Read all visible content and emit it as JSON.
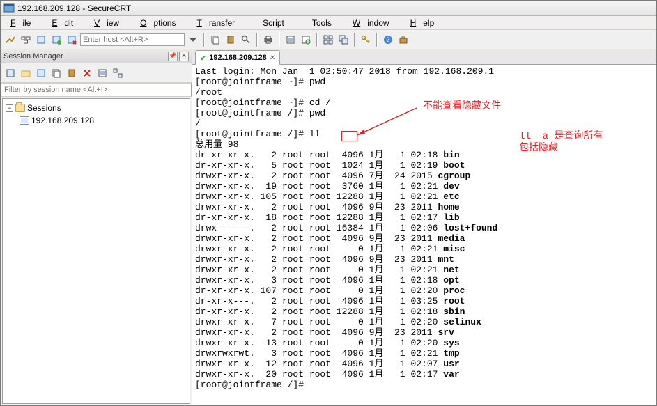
{
  "window": {
    "title": "192.168.209.128 - SecureCRT"
  },
  "menu": {
    "file": "File",
    "edit": "Edit",
    "view": "View",
    "options": "Options",
    "transfer": "Transfer",
    "script": "Script",
    "tools": "Tools",
    "window": "Window",
    "help": "Help"
  },
  "toolbar": {
    "host_placeholder": "Enter host <Alt+R>"
  },
  "session_manager": {
    "title": "Session Manager",
    "filter_placeholder": "Filter by session name <Alt+I>",
    "root": "Sessions",
    "items": [
      "192.168.209.128"
    ]
  },
  "tab": {
    "label": "192.168.209.128"
  },
  "annotations": {
    "a1": "不能查看隐藏文件",
    "a2_l1": "ll -a  是查询所有",
    "a2_l2": "包括隐藏"
  },
  "terminal": {
    "lines": [
      {
        "t": "Last login: Mon Jan  1 02:50:47 2018 from 192.168.209.1"
      },
      {
        "t": "[root@jointframe ~]# pwd"
      },
      {
        "t": "/root"
      },
      {
        "t": "[root@jointframe ~]# cd /"
      },
      {
        "t": "[root@jointframe /]# pwd"
      },
      {
        "t": "/"
      },
      {
        "t": "[root@jointframe /]# ll"
      },
      {
        "t": "总用量 98"
      },
      {
        "pre": "dr-xr-xr-x.   2 root root  4096 1月   1 02:18 ",
        "b": "bin"
      },
      {
        "pre": "dr-xr-xr-x.   5 root root  1024 1月   1 02:19 ",
        "b": "boot"
      },
      {
        "pre": "drwxr-xr-x.   2 root root  4096 7月  24 2015 ",
        "b": "cgroup"
      },
      {
        "pre": "drwxr-xr-x.  19 root root  3760 1月   1 02:21 ",
        "b": "dev"
      },
      {
        "pre": "drwxr-xr-x. 105 root root 12288 1月   1 02:21 ",
        "b": "etc"
      },
      {
        "pre": "drwxr-xr-x.   2 root root  4096 9月  23 2011 ",
        "b": "home"
      },
      {
        "pre": "dr-xr-xr-x.  18 root root 12288 1月   1 02:17 ",
        "b": "lib"
      },
      {
        "pre": "drwx------.   2 root root 16384 1月   1 02:06 ",
        "b": "lost+found"
      },
      {
        "pre": "drwxr-xr-x.   2 root root  4096 9月  23 2011 ",
        "b": "media"
      },
      {
        "pre": "drwxr-xr-x.   2 root root     0 1月   1 02:21 ",
        "b": "misc"
      },
      {
        "pre": "drwxr-xr-x.   2 root root  4096 9月  23 2011 ",
        "b": "mnt"
      },
      {
        "pre": "drwxr-xr-x.   2 root root     0 1月   1 02:21 ",
        "b": "net"
      },
      {
        "pre": "drwxr-xr-x.   3 root root  4096 1月   1 02:18 ",
        "b": "opt"
      },
      {
        "pre": "dr-xr-xr-x. 107 root root     0 1月   1 02:20 ",
        "b": "proc"
      },
      {
        "pre": "dr-xr-x---.   2 root root  4096 1月   1 03:25 ",
        "b": "root"
      },
      {
        "pre": "dr-xr-xr-x.   2 root root 12288 1月   1 02:18 ",
        "b": "sbin"
      },
      {
        "pre": "drwxr-xr-x.   7 root root     0 1月   1 02:20 ",
        "b": "selinux"
      },
      {
        "pre": "drwxr-xr-x.   2 root root  4096 9月  23 2011 ",
        "b": "srv"
      },
      {
        "pre": "drwxr-xr-x.  13 root root     0 1月   1 02:20 ",
        "b": "sys"
      },
      {
        "pre": "drwxrwxrwt.   3 root root  4096 1月   1 02:21 ",
        "b": "tmp"
      },
      {
        "pre": "drwxr-xr-x.  12 root root  4096 1月   1 02:07 ",
        "b": "usr"
      },
      {
        "pre": "drwxr-xr-x.  20 root root  4096 1月   1 02:17 ",
        "b": "var"
      },
      {
        "t": "[root@jointframe /]# "
      }
    ]
  }
}
